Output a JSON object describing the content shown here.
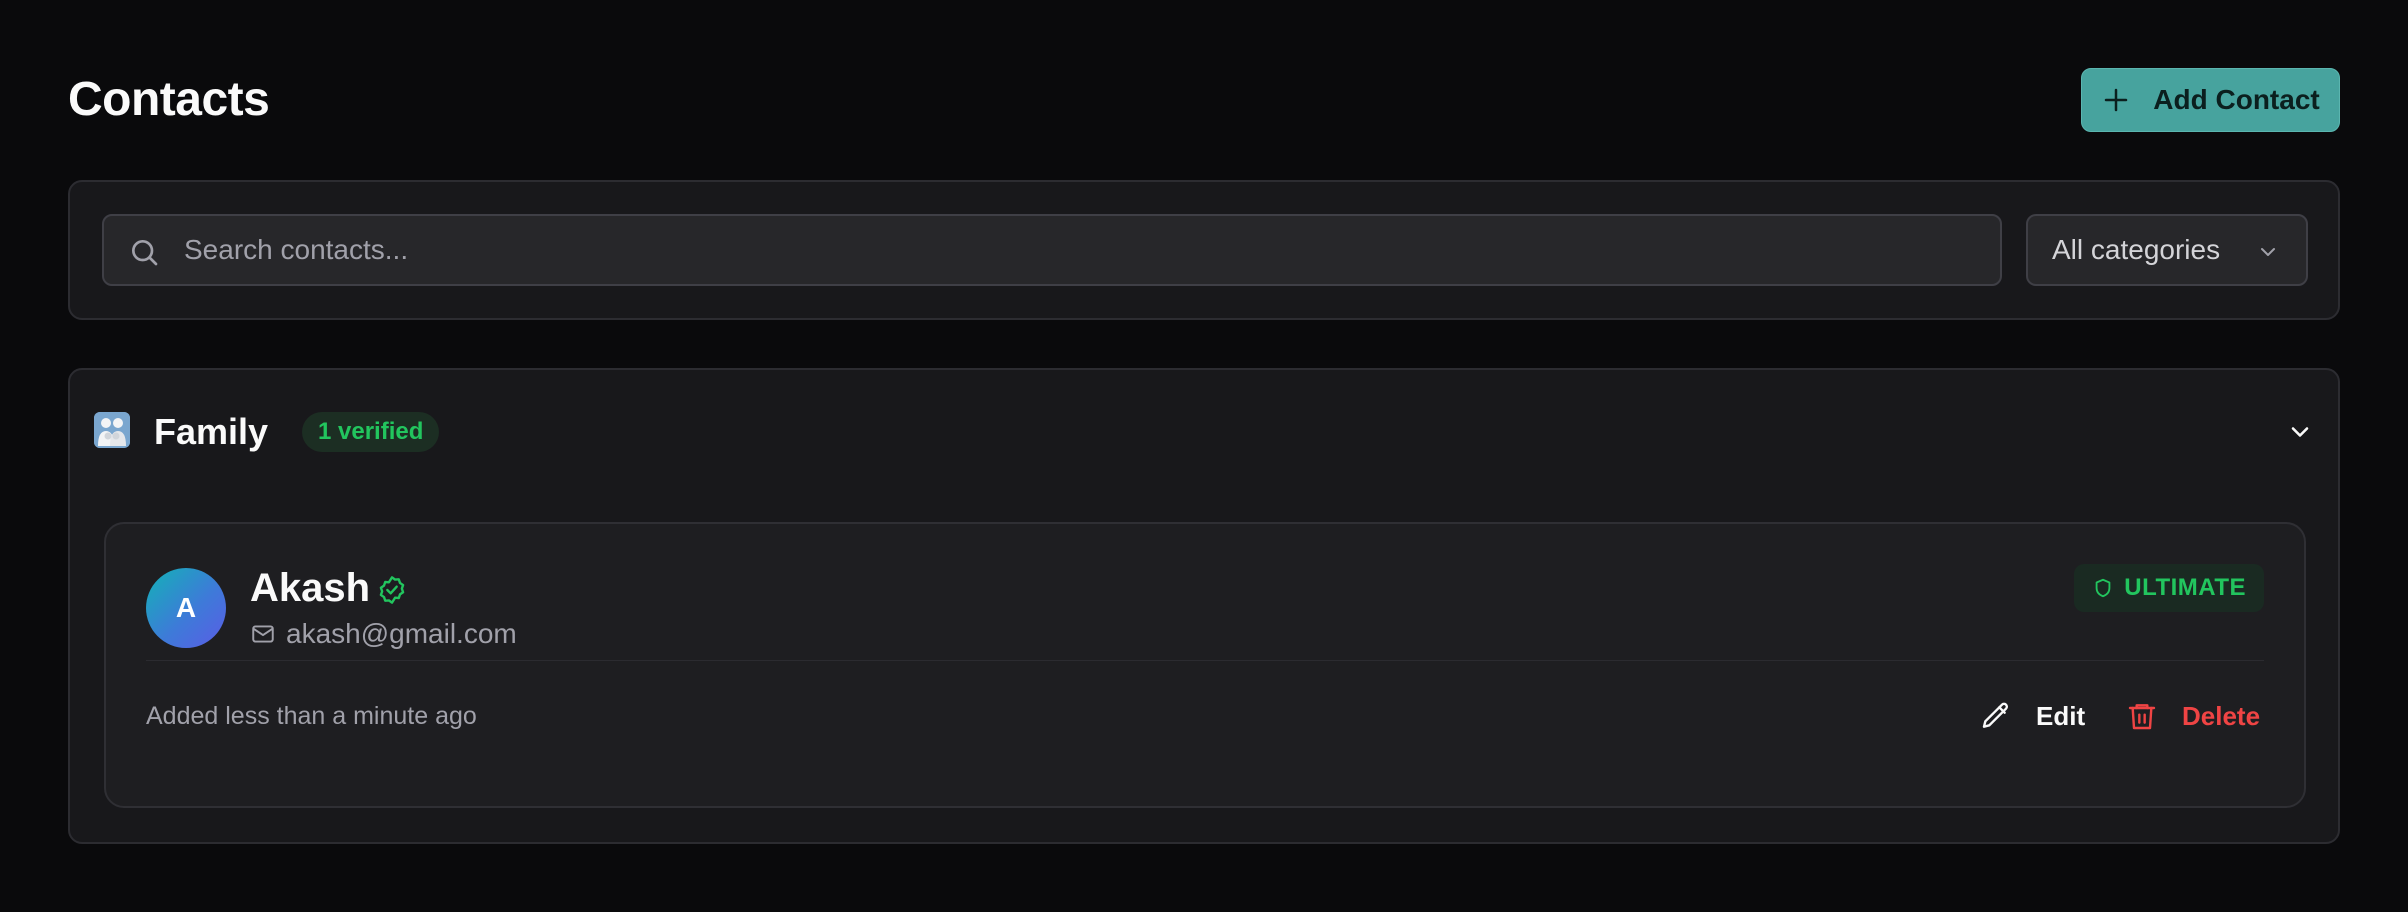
{
  "header": {
    "title": "Contacts",
    "add_button_label": "Add Contact"
  },
  "filters": {
    "search_placeholder": "Search contacts...",
    "search_value": "",
    "category_selected": "All categories"
  },
  "groups": [
    {
      "name": "Family",
      "icon": "family-emoji-icon",
      "verified_label": "1 verified",
      "expanded": true,
      "contacts": [
        {
          "initial": "A",
          "name": "Akash",
          "email": "akash@gmail.com",
          "tier": "ULTIMATE",
          "added": "Added less than a minute ago",
          "edit_label": "Edit",
          "delete_label": "Delete"
        }
      ]
    }
  ],
  "colors": {
    "background": "#0a0a0c",
    "panel": "#18181b",
    "accent": "#47a39e",
    "verified_green": "#22c55e",
    "danger": "#ef4444"
  }
}
